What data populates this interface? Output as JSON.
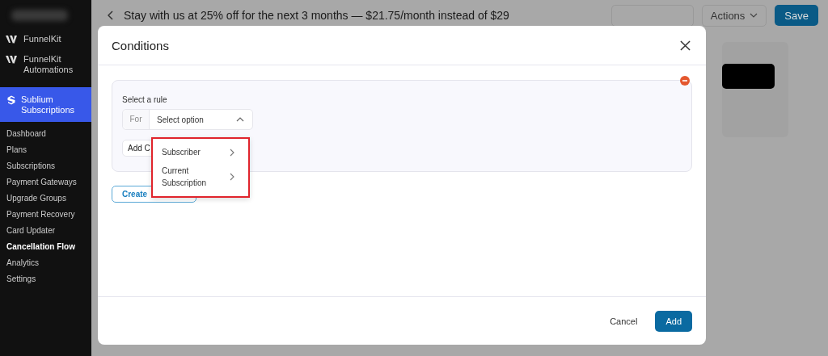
{
  "sidebar": {
    "items": [
      {
        "label": "FunnelKit",
        "kind": "funnel",
        "selected": false
      },
      {
        "label": "FunnelKit Automations",
        "kind": "funnel",
        "selected": false
      },
      {
        "label": "Sublium Subscriptions",
        "kind": "sublium",
        "selected": true
      }
    ],
    "submenu": [
      {
        "label": "Dashboard",
        "selected": false
      },
      {
        "label": "Plans",
        "selected": false
      },
      {
        "label": "Subscriptions",
        "selected": false
      },
      {
        "label": "Payment Gateways",
        "selected": false
      },
      {
        "label": "Upgrade Groups",
        "selected": false
      },
      {
        "label": "Payment Recovery",
        "selected": false
      },
      {
        "label": "Card Updater",
        "selected": false
      },
      {
        "label": "Cancellation Flow",
        "selected": true
      },
      {
        "label": "Analytics",
        "selected": false
      },
      {
        "label": "Settings",
        "selected": false
      }
    ]
  },
  "header": {
    "title": "Stay with us at 25% off for the next 3 months — $21.75/month instead of $29",
    "actions": "Actions",
    "save": "Save"
  },
  "dialog": {
    "title": "Conditions",
    "rule_label": "Select a rule",
    "prefix": "For",
    "select": {
      "placeholder": "Select option",
      "expanded": true
    },
    "add_condition": "Add C",
    "create_group": "Create",
    "menu": [
      {
        "label": "Subscriber"
      },
      {
        "label": "Current Subscription"
      }
    ],
    "cancel": "Cancel",
    "add": "Add"
  }
}
